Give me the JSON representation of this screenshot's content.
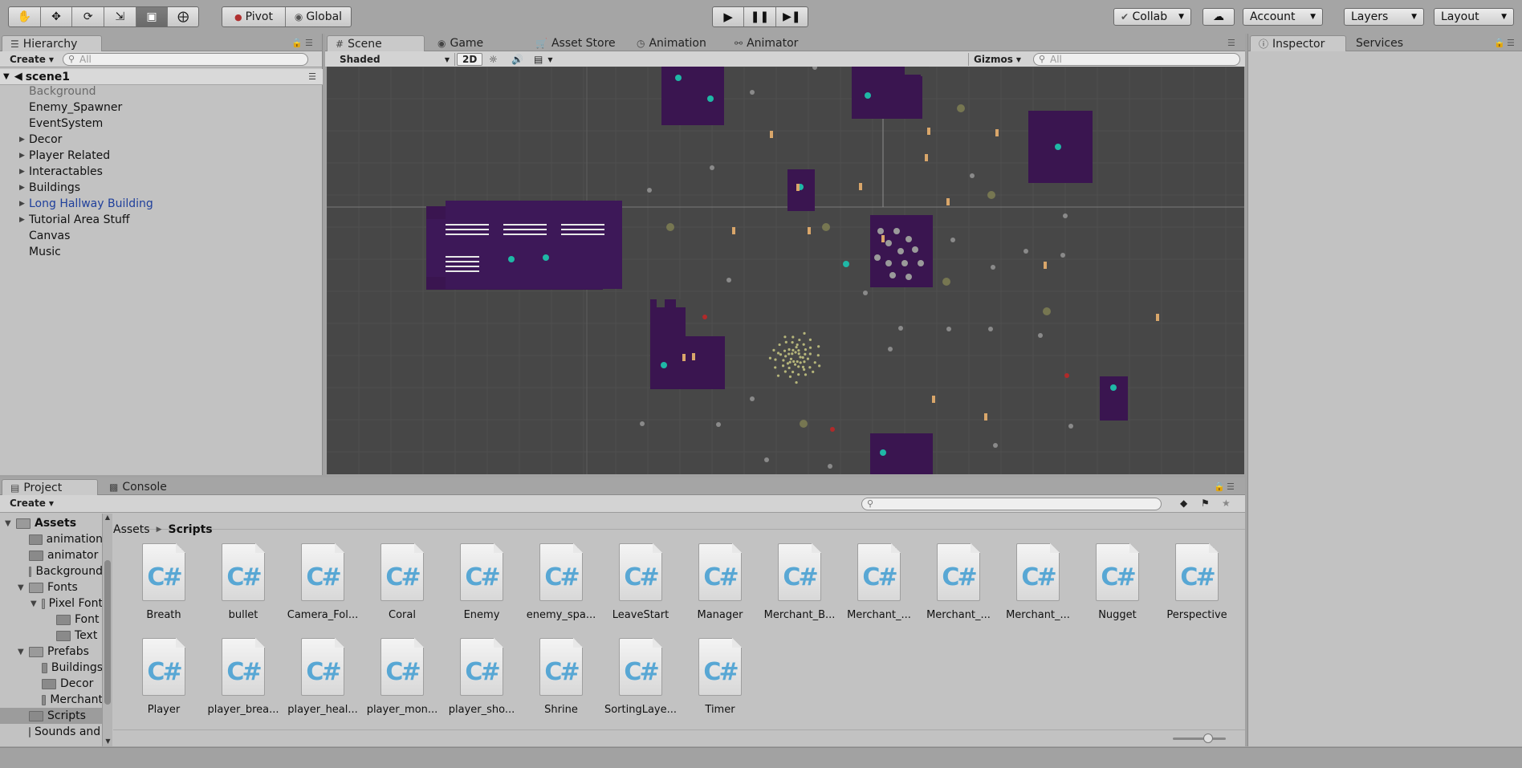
{
  "toolbar": {
    "tools": [
      "hand-tool",
      "move-tool",
      "rotate-tool",
      "scale-tool",
      "rect-tool",
      "transform-tool"
    ],
    "pivot": "Pivot",
    "global": "Global",
    "collab": "Collab",
    "account": "Account",
    "layers": "Layers",
    "layout": "Layout"
  },
  "hierarchy": {
    "tab": "Hierarchy",
    "create": "Create",
    "search_placeholder": "All",
    "scene": "scene1",
    "items": [
      {
        "label": "Background",
        "expandable": false,
        "style": "disabled"
      },
      {
        "label": "Enemy_Spawner",
        "expandable": false,
        "style": "normal"
      },
      {
        "label": "EventSystem",
        "expandable": false,
        "style": "normal"
      },
      {
        "label": "Decor",
        "expandable": true,
        "style": "normal"
      },
      {
        "label": "Player Related",
        "expandable": true,
        "style": "normal"
      },
      {
        "label": "Interactables",
        "expandable": true,
        "style": "normal"
      },
      {
        "label": "Buildings",
        "expandable": true,
        "style": "normal"
      },
      {
        "label": "Long Hallway Building",
        "expandable": true,
        "style": "prefab"
      },
      {
        "label": "Tutorial Area Stuff",
        "expandable": true,
        "style": "normal"
      },
      {
        "label": "Canvas",
        "expandable": false,
        "style": "normal"
      },
      {
        "label": "Music",
        "expandable": false,
        "style": "normal"
      }
    ]
  },
  "scene_tabs": {
    "scene": "Scene",
    "game": "Game",
    "asset_store": "Asset Store",
    "animation": "Animation",
    "animator": "Animator"
  },
  "scene_bar": {
    "shading": "Shaded",
    "mode_2d": "2D",
    "gizmos": "Gizmos",
    "search_placeholder": "All"
  },
  "inspector": {
    "tab": "Inspector",
    "services": "Services"
  },
  "project": {
    "tab": "Project",
    "console": "Console",
    "create": "Create",
    "breadcrumb": [
      "Assets",
      "Scripts"
    ],
    "tree": [
      {
        "label": "Assets",
        "depth": 0,
        "open": true,
        "bold": true
      },
      {
        "label": "animation",
        "depth": 1,
        "open": false
      },
      {
        "label": "animator",
        "depth": 1,
        "open": false
      },
      {
        "label": "Background",
        "depth": 1,
        "open": false
      },
      {
        "label": "Fonts",
        "depth": 1,
        "open": true,
        "expander": true
      },
      {
        "label": "Pixel Font",
        "depth": 2,
        "open": true,
        "expander": true
      },
      {
        "label": "Font",
        "depth": 3,
        "open": false
      },
      {
        "label": "Text",
        "depth": 3,
        "open": false
      },
      {
        "label": "Prefabs",
        "depth": 1,
        "open": true,
        "expander": true
      },
      {
        "label": "Buildings",
        "depth": 2,
        "open": false
      },
      {
        "label": "Decor",
        "depth": 2,
        "open": false
      },
      {
        "label": "Merchant",
        "depth": 2,
        "open": false
      },
      {
        "label": "Scripts",
        "depth": 1,
        "open": false,
        "selected": true
      },
      {
        "label": "Sounds and Music",
        "depth": 1,
        "open": false
      }
    ],
    "scripts_row1": [
      "Breath",
      "bullet",
      "Camera_Fol...",
      "Coral",
      "Enemy",
      "enemy_spa...",
      "LeaveStart",
      "Manager",
      "Merchant_B...",
      "Merchant_...",
      "Merchant_...",
      "Merchant_...",
      "Nugget",
      "Perspective"
    ],
    "scripts_row2": [
      "Player",
      "player_brea...",
      "player_heal...",
      "player_mon...",
      "player_sho...",
      "Shrine",
      "SortingLaye...",
      "Timer"
    ]
  },
  "colors": {
    "scene_bg": "#474747",
    "building": "#3a1550",
    "prefab_text": "#1f3f9b",
    "csharp": "#58a7d4"
  }
}
